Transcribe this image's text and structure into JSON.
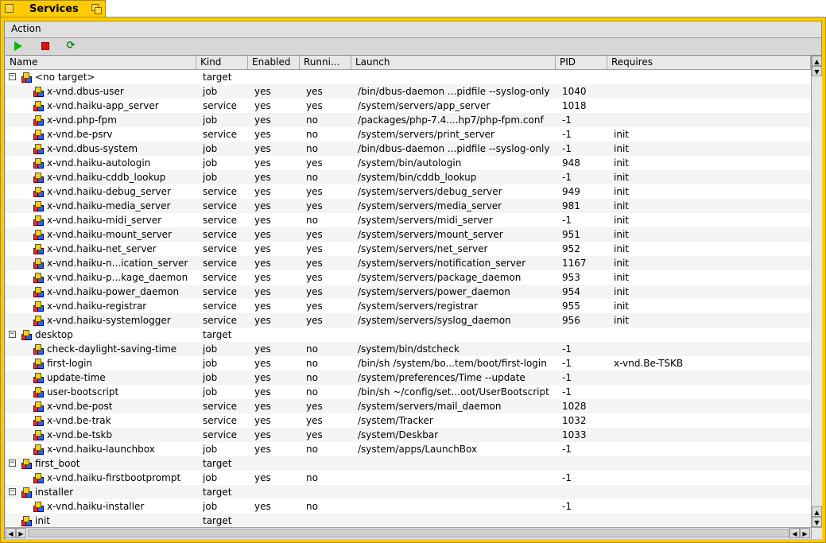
{
  "window": {
    "title": "Services"
  },
  "menu": {
    "action": "Action"
  },
  "toolbar": {
    "start_icon": "play-icon",
    "stop_icon": "stop-icon",
    "restart_icon": "restart-icon"
  },
  "columns": [
    "Name",
    "Kind",
    "Enabled",
    "Runni...",
    "Launch",
    "PID",
    "Requires"
  ],
  "rows": [
    {
      "level": 0,
      "expander": "−",
      "name": "<no target>",
      "kind": "target",
      "enabled": "",
      "running": "",
      "launch": "",
      "pid": "",
      "requires": ""
    },
    {
      "level": 1,
      "name": "x-vnd.dbus-user",
      "kind": "job",
      "enabled": "yes",
      "running": "yes",
      "launch": "/bin/dbus-daemon ...pidfile --syslog-only",
      "pid": "1040",
      "requires": ""
    },
    {
      "level": 1,
      "name": "x-vnd.haiku-app_server",
      "kind": "service",
      "enabled": "yes",
      "running": "yes",
      "launch": "/system/servers/app_server",
      "pid": "1018",
      "requires": ""
    },
    {
      "level": 1,
      "name": "x-vnd.php-fpm",
      "kind": "job",
      "enabled": "yes",
      "running": "no",
      "launch": "/packages/php-7.4....hp7/php-fpm.conf",
      "pid": "-1",
      "requires": ""
    },
    {
      "level": 1,
      "name": "x-vnd.be-psrv",
      "kind": "service",
      "enabled": "yes",
      "running": "no",
      "launch": "/system/servers/print_server",
      "pid": "-1",
      "requires": "init"
    },
    {
      "level": 1,
      "name": "x-vnd.dbus-system",
      "kind": "job",
      "enabled": "yes",
      "running": "no",
      "launch": "/bin/dbus-daemon ...pidfile --syslog-only",
      "pid": "-1",
      "requires": "init"
    },
    {
      "level": 1,
      "name": "x-vnd.haiku-autologin",
      "kind": "job",
      "enabled": "yes",
      "running": "yes",
      "launch": "/system/bin/autologin",
      "pid": "948",
      "requires": "init"
    },
    {
      "level": 1,
      "name": "x-vnd.haiku-cddb_lookup",
      "kind": "job",
      "enabled": "yes",
      "running": "no",
      "launch": "/system/bin/cddb_lookup",
      "pid": "-1",
      "requires": "init"
    },
    {
      "level": 1,
      "name": "x-vnd.haiku-debug_server",
      "kind": "service",
      "enabled": "yes",
      "running": "yes",
      "launch": "/system/servers/debug_server",
      "pid": "949",
      "requires": "init"
    },
    {
      "level": 1,
      "name": "x-vnd.haiku-media_server",
      "kind": "service",
      "enabled": "yes",
      "running": "yes",
      "launch": "/system/servers/media_server",
      "pid": "981",
      "requires": "init"
    },
    {
      "level": 1,
      "name": "x-vnd.haiku-midi_server",
      "kind": "service",
      "enabled": "yes",
      "running": "no",
      "launch": "/system/servers/midi_server",
      "pid": "-1",
      "requires": "init"
    },
    {
      "level": 1,
      "name": "x-vnd.haiku-mount_server",
      "kind": "service",
      "enabled": "yes",
      "running": "yes",
      "launch": "/system/servers/mount_server",
      "pid": "951",
      "requires": "init"
    },
    {
      "level": 1,
      "name": "x-vnd.haiku-net_server",
      "kind": "service",
      "enabled": "yes",
      "running": "yes",
      "launch": "/system/servers/net_server",
      "pid": "952",
      "requires": "init"
    },
    {
      "level": 1,
      "name": "x-vnd.haiku-n...ication_server",
      "kind": "service",
      "enabled": "yes",
      "running": "yes",
      "launch": "/system/servers/notification_server",
      "pid": "1167",
      "requires": "init"
    },
    {
      "level": 1,
      "name": "x-vnd.haiku-p...kage_daemon",
      "kind": "service",
      "enabled": "yes",
      "running": "yes",
      "launch": "/system/servers/package_daemon",
      "pid": "953",
      "requires": "init"
    },
    {
      "level": 1,
      "name": "x-vnd.haiku-power_daemon",
      "kind": "service",
      "enabled": "yes",
      "running": "yes",
      "launch": "/system/servers/power_daemon",
      "pid": "954",
      "requires": "init"
    },
    {
      "level": 1,
      "name": "x-vnd.haiku-registrar",
      "kind": "service",
      "enabled": "yes",
      "running": "yes",
      "launch": "/system/servers/registrar",
      "pid": "955",
      "requires": "init"
    },
    {
      "level": 1,
      "name": "x-vnd.haiku-systemlogger",
      "kind": "service",
      "enabled": "yes",
      "running": "yes",
      "launch": "/system/servers/syslog_daemon",
      "pid": "956",
      "requires": "init"
    },
    {
      "level": 0,
      "expander": "−",
      "name": "desktop",
      "kind": "target",
      "enabled": "",
      "running": "",
      "launch": "",
      "pid": "",
      "requires": ""
    },
    {
      "level": 1,
      "name": "check-daylight-saving-time",
      "kind": "job",
      "enabled": "yes",
      "running": "no",
      "launch": "/system/bin/dstcheck",
      "pid": "-1",
      "requires": ""
    },
    {
      "level": 1,
      "name": "first-login",
      "kind": "job",
      "enabled": "yes",
      "running": "no",
      "launch": "/bin/sh /system/bo...tem/boot/first-login",
      "pid": "-1",
      "requires": "x-vnd.Be-TSKB"
    },
    {
      "level": 1,
      "name": "update-time",
      "kind": "job",
      "enabled": "yes",
      "running": "no",
      "launch": "/system/preferences/Time --update",
      "pid": "-1",
      "requires": ""
    },
    {
      "level": 1,
      "name": "user-bootscript",
      "kind": "job",
      "enabled": "yes",
      "running": "no",
      "launch": "/bin/sh ~/config/set...oot/UserBootscript",
      "pid": "-1",
      "requires": ""
    },
    {
      "level": 1,
      "name": "x-vnd.be-post",
      "kind": "service",
      "enabled": "yes",
      "running": "yes",
      "launch": "/system/servers/mail_daemon",
      "pid": "1028",
      "requires": ""
    },
    {
      "level": 1,
      "name": "x-vnd.be-trak",
      "kind": "service",
      "enabled": "yes",
      "running": "yes",
      "launch": "/system/Tracker",
      "pid": "1032",
      "requires": ""
    },
    {
      "level": 1,
      "name": "x-vnd.be-tskb",
      "kind": "service",
      "enabled": "yes",
      "running": "yes",
      "launch": "/system/Deskbar",
      "pid": "1033",
      "requires": ""
    },
    {
      "level": 1,
      "name": "x-vnd.haiku-launchbox",
      "kind": "job",
      "enabled": "yes",
      "running": "no",
      "launch": "/system/apps/LaunchBox",
      "pid": "-1",
      "requires": ""
    },
    {
      "level": 0,
      "expander": "−",
      "name": "first_boot",
      "kind": "target",
      "enabled": "",
      "running": "",
      "launch": "",
      "pid": "",
      "requires": ""
    },
    {
      "level": 1,
      "name": "x-vnd.haiku-firstbootprompt",
      "kind": "job",
      "enabled": "yes",
      "running": "no",
      "launch": "",
      "pid": "-1",
      "requires": ""
    },
    {
      "level": 0,
      "expander": "−",
      "name": "installer",
      "kind": "target",
      "enabled": "",
      "running": "",
      "launch": "",
      "pid": "",
      "requires": ""
    },
    {
      "level": 1,
      "name": "x-vnd.haiku-installer",
      "kind": "job",
      "enabled": "yes",
      "running": "no",
      "launch": "",
      "pid": "-1",
      "requires": ""
    },
    {
      "level": 0,
      "expander": "",
      "name": "init",
      "kind": "target",
      "enabled": "",
      "running": "",
      "launch": "",
      "pid": "",
      "requires": ""
    }
  ]
}
